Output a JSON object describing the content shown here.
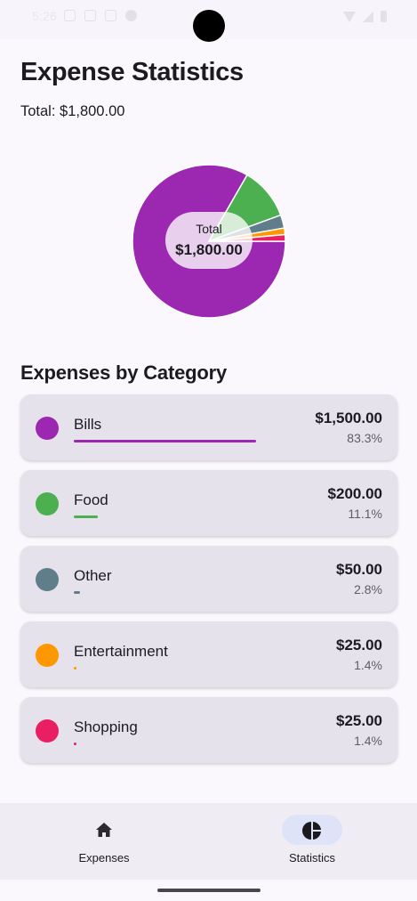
{
  "status_bar": {
    "time": "5:26"
  },
  "header": {
    "title": "Expense Statistics",
    "total_label": "Total: $1,800.00"
  },
  "pie": {
    "center_label": "Total",
    "center_value": "$1,800.00"
  },
  "chart_data": {
    "type": "pie",
    "categories": [
      "Bills",
      "Food",
      "Other",
      "Entertainment",
      "Shopping"
    ],
    "values": [
      1500,
      200,
      50,
      25,
      25
    ],
    "percentages": [
      83.3,
      11.1,
      2.8,
      1.4,
      1.4
    ],
    "colors": [
      "#9c27b0",
      "#4caf50",
      "#607d8b",
      "#ff9800",
      "#e91e63"
    ],
    "title": "",
    "legend": "none"
  },
  "section": {
    "title": "Expenses by Category"
  },
  "categories": [
    {
      "name": "Bills",
      "amount": "$1,500.00",
      "percent": "83.3%",
      "fraction": 0.833,
      "color": "#9c27b0"
    },
    {
      "name": "Food",
      "amount": "$200.00",
      "percent": "11.1%",
      "fraction": 0.111,
      "color": "#4caf50"
    },
    {
      "name": "Other",
      "amount": "$50.00",
      "percent": "2.8%",
      "fraction": 0.028,
      "color": "#607d8b"
    },
    {
      "name": "Entertainment",
      "amount": "$25.00",
      "percent": "1.4%",
      "fraction": 0.014,
      "color": "#ff9800"
    },
    {
      "name": "Shopping",
      "amount": "$25.00",
      "percent": "1.4%",
      "fraction": 0.014,
      "color": "#e91e63"
    }
  ],
  "bottom_nav": {
    "items": [
      {
        "label": "Expenses",
        "icon": "home-icon",
        "selected": false
      },
      {
        "label": "Statistics",
        "icon": "pie-chart-icon",
        "selected": true
      }
    ],
    "selected_pill_color": "#dfe3f8"
  }
}
